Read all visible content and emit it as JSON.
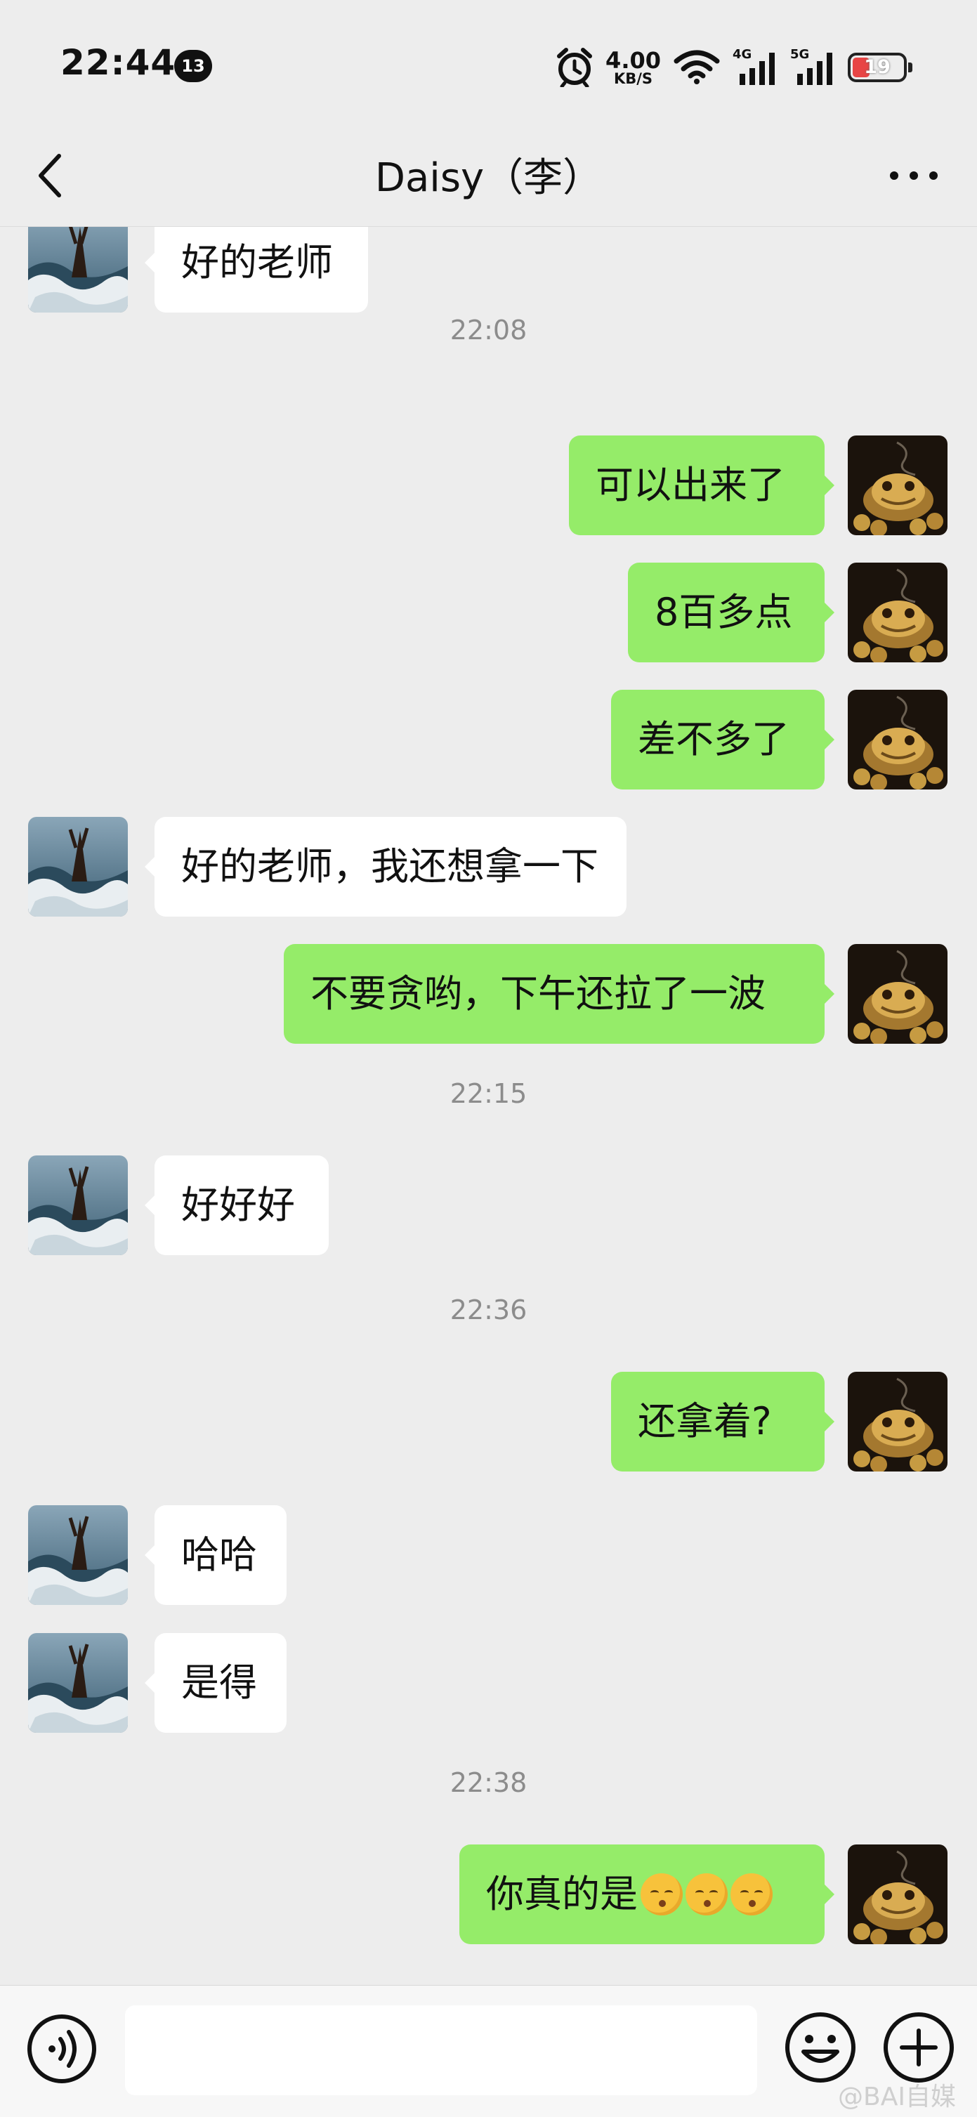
{
  "status_bar": {
    "time": "22:44",
    "notification_count": "13",
    "net_speed": "4.00",
    "net_speed_unit": "KB/S",
    "sim1_label": "4G",
    "sim2_label": "5G",
    "battery_level": "19",
    "icons": [
      "alarm-clock-icon",
      "wifi-icon",
      "signal-icon",
      "signal-icon",
      "battery-icon"
    ]
  },
  "nav": {
    "title": "Daisy（李）",
    "back_icon": "chevron-left-icon",
    "more_icon": "more-dots-icon"
  },
  "messages": [
    {
      "type": "text",
      "side": "left",
      "text": "好的老师"
    },
    {
      "type": "time",
      "text": "22:08"
    },
    {
      "type": "text",
      "side": "right",
      "text": "可以出来了"
    },
    {
      "type": "text",
      "side": "right",
      "text": "8百多点"
    },
    {
      "type": "text",
      "side": "right",
      "text": "差不多了"
    },
    {
      "type": "text",
      "side": "left",
      "text": "好的老师，我还想拿一下"
    },
    {
      "type": "text",
      "side": "right",
      "text": "不要贪哟，下午还拉了一波"
    },
    {
      "type": "time",
      "text": "22:15"
    },
    {
      "type": "text",
      "side": "left",
      "text": "好好好"
    },
    {
      "type": "time",
      "text": "22:36"
    },
    {
      "type": "text",
      "side": "right",
      "text": "还拿着?"
    },
    {
      "type": "text",
      "side": "left",
      "text": "哈哈"
    },
    {
      "type": "text",
      "side": "left",
      "text": "是得"
    },
    {
      "type": "time",
      "text": "22:38"
    },
    {
      "type": "text",
      "side": "right",
      "text": "你真的是",
      "emoji_count": 3,
      "emoji_name": "kissing-face-closed-eyes-emoji"
    }
  ],
  "input_bar": {
    "value": "",
    "voice_icon": "voice-icon",
    "emoji_icon": "emoji-icon",
    "plus_icon": "plus-icon"
  },
  "watermark": "@BAI自媒",
  "colors": {
    "background": "#ededed",
    "my_bubble": "#95ec69",
    "their_bubble": "#ffffff",
    "timestamp": "#8c8c8c"
  }
}
